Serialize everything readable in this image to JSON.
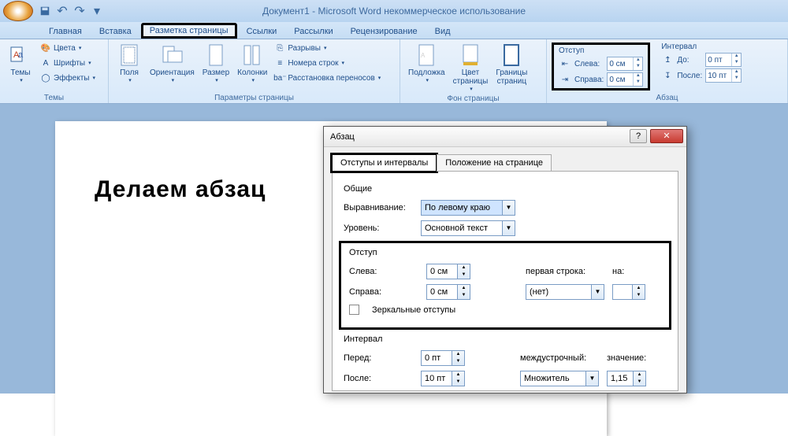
{
  "title": "Документ1 - Microsoft Word некоммерческое использование",
  "tabs": {
    "home": "Главная",
    "insert": "Вставка",
    "layout": "Разметка страницы",
    "refs": "Ссылки",
    "mail": "Рассылки",
    "review": "Рецензирование",
    "view": "Вид"
  },
  "ribbon": {
    "themes": {
      "label": "Темы",
      "btn": "Темы",
      "colors": "Цвета",
      "fonts": "Шрифты",
      "effects": "Эффекты"
    },
    "page_setup": {
      "label": "Параметры страницы",
      "margins": "Поля",
      "orientation": "Ориентация",
      "size": "Размер",
      "columns": "Колонки",
      "breaks": "Разрывы",
      "line_numbers": "Номера строк",
      "hyphenation": "Расстановка переносов"
    },
    "page_bg": {
      "label": "Фон страницы",
      "watermark": "Подложка",
      "color": "Цвет\nстраницы",
      "borders": "Границы\nстраниц"
    },
    "paragraph": {
      "label": "Абзац",
      "indent_head": "Отступ",
      "spacing_head": "Интервал",
      "left_lbl": "Слева:",
      "right_lbl": "Справа:",
      "before_lbl": "До:",
      "after_lbl": "После:",
      "left": "0 см",
      "right": "0 см",
      "before": "0 пт",
      "after": "10 пт"
    }
  },
  "doc_text": "Делаем абзац",
  "dialog": {
    "title": "Абзац",
    "tab1": "Отступы и интервалы",
    "tab2": "Положение на странице",
    "general": "Общие",
    "align_lbl": "Выравнивание:",
    "align_val": "По левому краю",
    "level_lbl": "Уровень:",
    "level_val": "Основной текст",
    "indent_head": "Отступ",
    "left_lbl": "Слева:",
    "left_val": "0 см",
    "right_lbl": "Справа:",
    "right_val": "0 см",
    "firstline_lbl": "первая строка:",
    "firstline_val": "(нет)",
    "by_lbl": "на:",
    "mirror": "Зеркальные отступы",
    "spacing_head": "Интервал",
    "before_lbl": "Перед:",
    "before_val": "0 пт",
    "after_lbl": "После:",
    "after_val": "10 пт",
    "line_lbl": "междустрочный:",
    "line_val": "Множитель",
    "val_lbl": "значение:",
    "val_val": "1,15"
  }
}
